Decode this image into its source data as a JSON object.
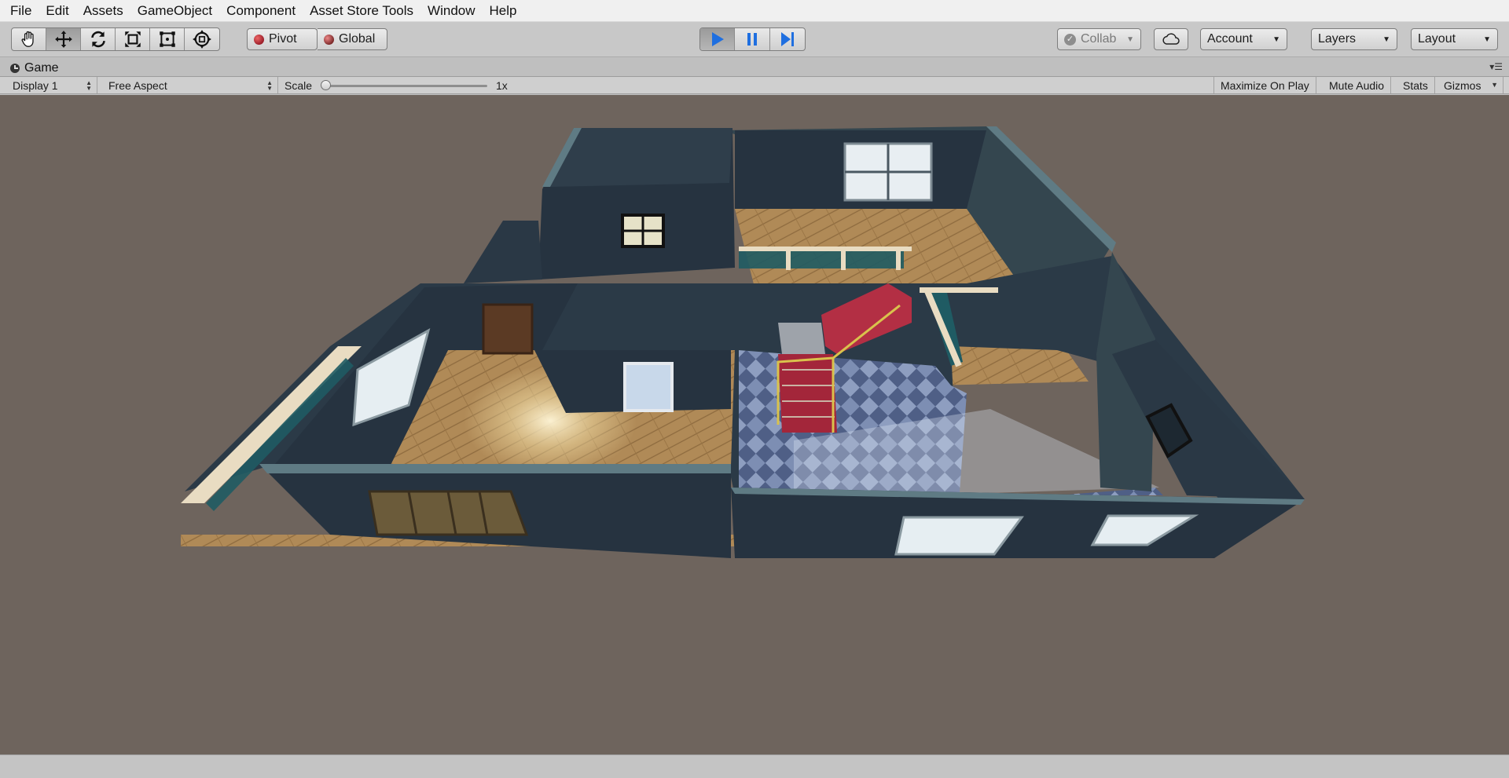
{
  "menu": [
    "File",
    "Edit",
    "Assets",
    "GameObject",
    "Component",
    "Asset Store Tools",
    "Window",
    "Help"
  ],
  "toolbar": {
    "tools": [
      "hand-tool",
      "move-tool",
      "rotate-tool",
      "scale-tool",
      "rect-tool",
      "transform-tool"
    ],
    "pivot_label": "Pivot",
    "global_label": "Global",
    "collab_label": "Collab",
    "account_label": "Account",
    "layers_label": "Layers",
    "layout_label": "Layout"
  },
  "game_view": {
    "tab_label": "Game",
    "display_label": "Display 1",
    "aspect_label": "Free Aspect",
    "scale_label": "Scale",
    "scale_value": "1x",
    "maximize_label": "Maximize On Play",
    "mute_label": "Mute Audio",
    "stats_label": "Stats",
    "gizmos_label": "Gizmos"
  },
  "colors": {
    "viewport_bg": "#6e645d",
    "wall_dark": "#263340",
    "wall_trim": "#5f7b84",
    "floor_wood": "#b6925f",
    "carpet": "#a3263a",
    "play_blue": "#1f6fe0"
  }
}
